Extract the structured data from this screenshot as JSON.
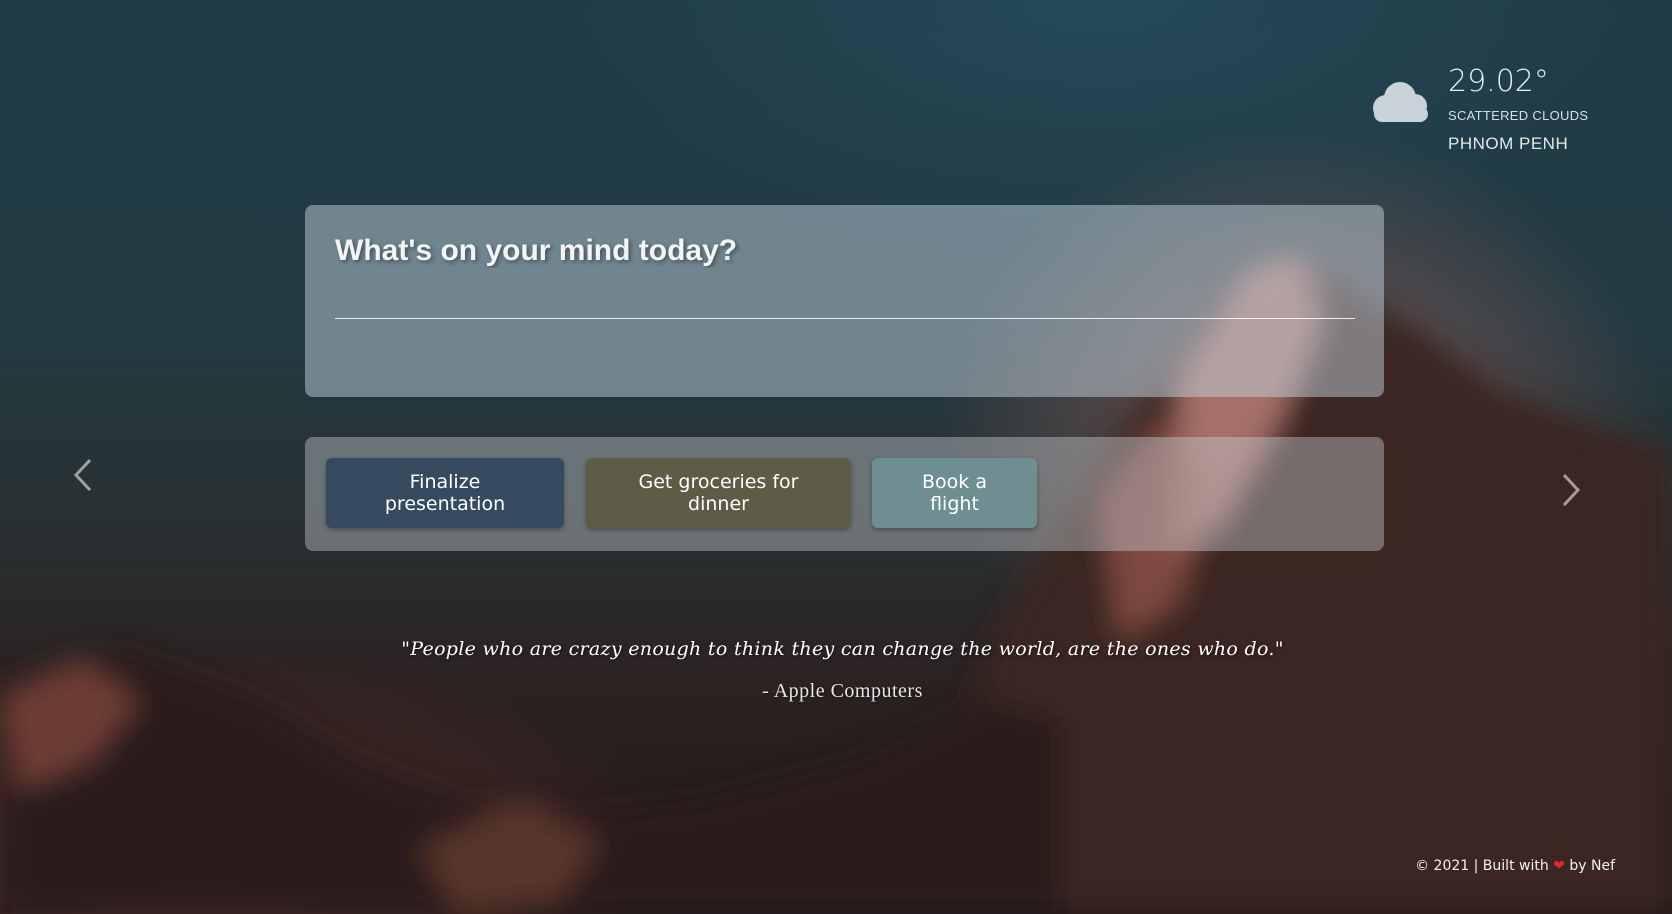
{
  "weather": {
    "icon": "cloud-icon",
    "temperature": "29.02°",
    "description": "SCATTERED CLOUDS",
    "city": "PHNOM PENH"
  },
  "mind": {
    "placeholder": "What's on your mind today?",
    "value": ""
  },
  "tasks": [
    {
      "label": "Finalize presentation",
      "color": "#354a5f"
    },
    {
      "label": "Get groceries for dinner",
      "color": "#5d5c47"
    },
    {
      "label": "Book a flight",
      "color": "#6e8e92"
    }
  ],
  "navigation": {
    "prev_icon": "chevron-left-icon",
    "next_icon": "chevron-right-icon"
  },
  "quote": {
    "text": "\"People who are crazy enough to think they can change the world, are the ones who do.\"",
    "author": "- Apple Computers"
  },
  "footer": {
    "prefix": "© 2021 | Built with",
    "heart": "❤",
    "suffix": "by Nef"
  },
  "colors": {
    "heart": "#e0282c",
    "card_background": "rgba(200,215,225,0.48)"
  }
}
